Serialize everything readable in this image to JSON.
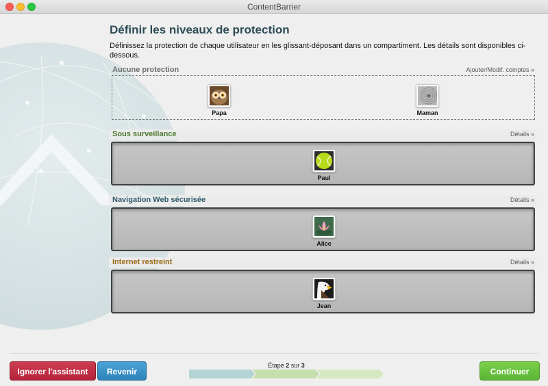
{
  "window": {
    "title": "ContentBarrier"
  },
  "page": {
    "heading": "Définir les niveaux de protection",
    "intro": "Définissez la protection de chaque utilisateur en les glissant-déposant dans un compartiment. Les détails sont disponibles ci-dessous."
  },
  "sections": {
    "none": {
      "title": "Aucune protection",
      "link": "Ajouter/Modif. comptes »",
      "color": "#6e6e6e",
      "users": [
        {
          "name": "Papa",
          "icon": "owl-icon"
        },
        {
          "name": "Maman",
          "icon": "zen-stones-icon"
        }
      ]
    },
    "monitored": {
      "title": "Sous surveillance",
      "link": "Détails »",
      "color": "#4c7a2f",
      "users": [
        {
          "name": "Paul",
          "icon": "tennis-ball-icon"
        }
      ]
    },
    "safe_web": {
      "title": "Navigation Web sécurisée",
      "link": "Détails »",
      "color": "#2d5b6b",
      "users": [
        {
          "name": "Alice",
          "icon": "lotus-flower-icon"
        }
      ]
    },
    "restricted": {
      "title": "Internet restreint",
      "link": "Détails »",
      "color": "#9a6a16",
      "users": [
        {
          "name": "Jean",
          "icon": "eagle-icon"
        }
      ]
    }
  },
  "footer": {
    "skip_label": "Ignorer l'assistant",
    "back_label": "Revenir",
    "continue_label": "Continuer",
    "step_prefix": "Étape",
    "step_current": "2",
    "step_sep": "sur",
    "step_total": "3",
    "progress_fraction": 0.667,
    "colors": {
      "skip": "#b5233a",
      "back": "#2d83b8",
      "continue": "#5bb435"
    }
  }
}
